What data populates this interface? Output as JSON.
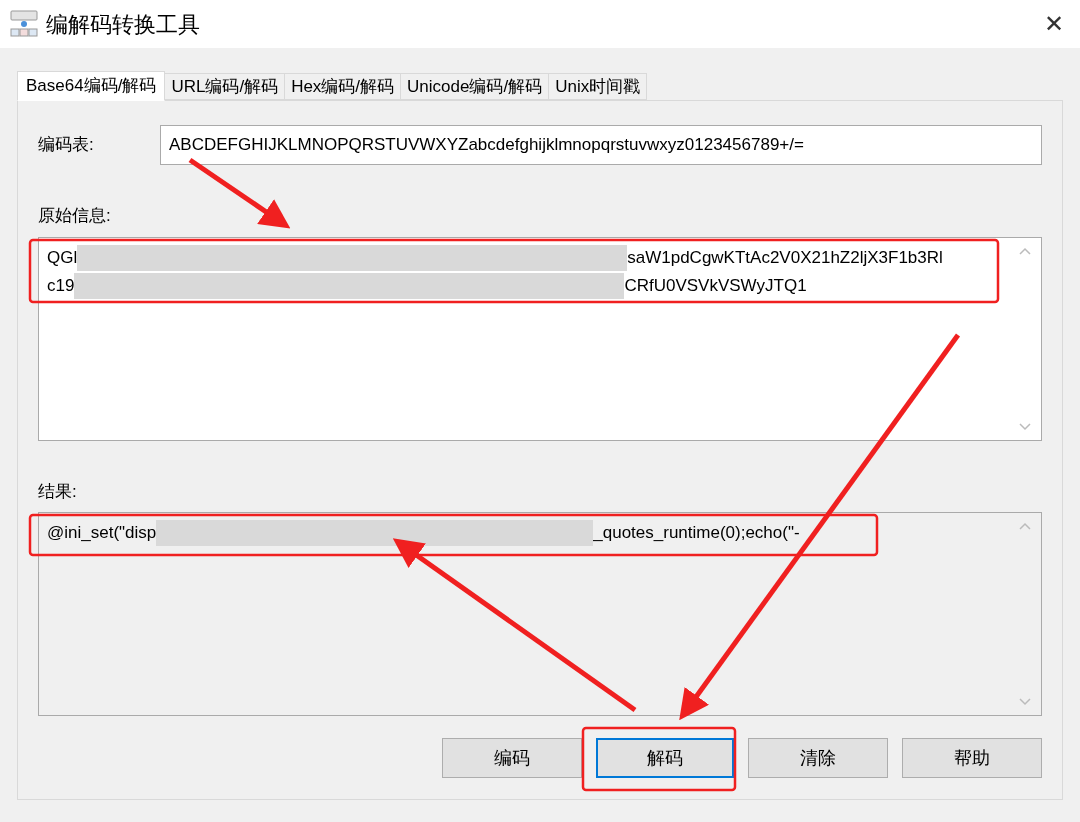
{
  "window": {
    "title": "编解码转换工具",
    "close": "✕"
  },
  "tabs": [
    {
      "label": "Base64编码/解码",
      "selected": true
    },
    {
      "label": "URL编码/解码",
      "selected": false
    },
    {
      "label": "Hex编码/解码",
      "selected": false
    },
    {
      "label": "Unicode编码/解码",
      "selected": false
    },
    {
      "label": "Unix时间戳",
      "selected": false
    }
  ],
  "alphabet": {
    "label": "编码表:",
    "value": "ABCDEFGHIJKLMNOPQRSTUVWXYZabcdefghijklmnopqrstuvwxyz0123456789+/="
  },
  "source": {
    "label": "原始信息:",
    "lines": [
      {
        "start": "QGl",
        "end": "saW1pdCgwKTtAc2V0X21hZ2ljX3F1b3Rl"
      },
      {
        "start": "c19",
        "end": "CRfU0VSVkVSWyJTQ1"
      }
    ]
  },
  "result": {
    "label": "结果:",
    "lines": [
      {
        "start": "@ini_set(\"disp",
        "end": "_quotes_runtime(0);echo(\"-"
      }
    ]
  },
  "buttons": [
    {
      "label": "编码",
      "focused": false
    },
    {
      "label": "解码",
      "focused": true
    },
    {
      "label": "清除",
      "focused": false
    },
    {
      "label": "帮助",
      "focused": false
    }
  ]
}
